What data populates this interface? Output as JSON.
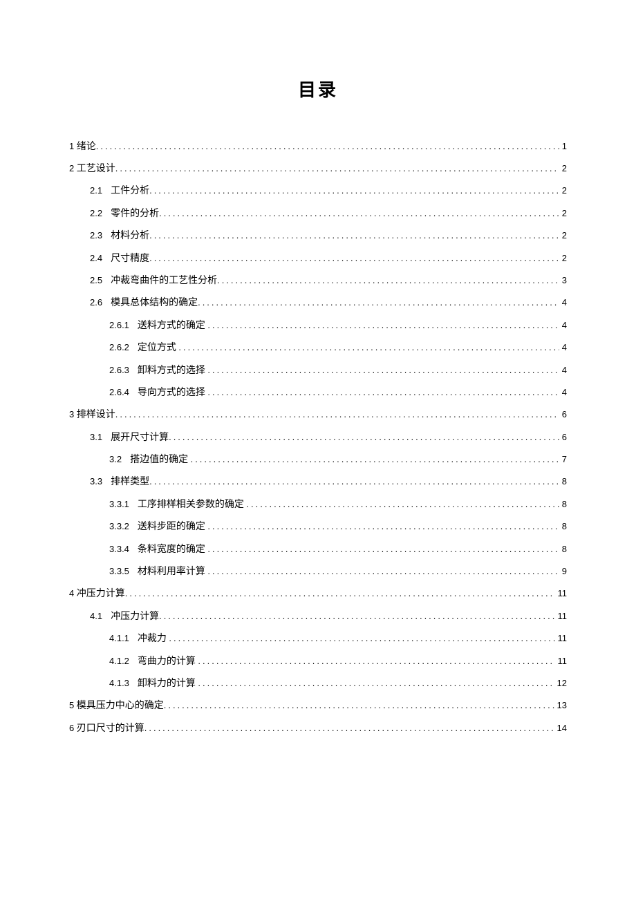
{
  "title": "目录",
  "entries": [
    {
      "level": 0,
      "num": "1",
      "label": "绪论",
      "page": "1",
      "gap": false
    },
    {
      "level": 0,
      "num": "2",
      "label": "工艺设计",
      "page": "2",
      "gap": false
    },
    {
      "level": 1,
      "num": "2.1",
      "label": "工件分析",
      "page": "2",
      "gap": true
    },
    {
      "level": 1,
      "num": "2.2",
      "label": "零件的分析",
      "page": "2",
      "gap": true
    },
    {
      "level": 1,
      "num": "2.3",
      "label": "材料分析",
      "page": "2",
      "gap": true
    },
    {
      "level": 1,
      "num": "2.4",
      "label": "尺寸精度",
      "page": "2",
      "gap": true
    },
    {
      "level": 1,
      "num": "2.5",
      "label": "冲裁弯曲件的工艺性分析",
      "page": "3",
      "gap": true
    },
    {
      "level": 1,
      "num": "2.6",
      "label": "模具总体结构的确定",
      "page": "4",
      "gap": true
    },
    {
      "level": 2,
      "num": "2.6.1",
      "label": "送料方式的确定",
      "page": "4",
      "gap": true
    },
    {
      "level": 2,
      "num": "2.6.2",
      "label": "定位方式",
      "page": "4",
      "gap": true
    },
    {
      "level": 2,
      "num": "2.6.3",
      "label": "卸料方式的选择",
      "page": "4",
      "gap": true
    },
    {
      "level": 2,
      "num": "2.6.4",
      "label": "导向方式的选择",
      "page": "4",
      "gap": true
    },
    {
      "level": 0,
      "num": "3",
      "label": "排样设计",
      "page": "6",
      "gap": false
    },
    {
      "level": 1,
      "num": "3.1",
      "label": "展开尺寸计算",
      "page": "6",
      "gap": true
    },
    {
      "level": 2,
      "num": "3.2",
      "label": "搭边值的确定",
      "page": "7",
      "gap": true
    },
    {
      "level": 1,
      "num": "3.3",
      "label": "排样类型",
      "page": "8",
      "gap": true
    },
    {
      "level": 2,
      "num": "3.3.1",
      "label": "工序排样相关参数的确定",
      "page": "8",
      "gap": true
    },
    {
      "level": 2,
      "num": "3.3.2",
      "label": "送料步距的确定",
      "page": "8",
      "gap": true
    },
    {
      "level": 2,
      "num": "3.3.4",
      "label": "条料宽度的确定",
      "page": "8",
      "gap": true
    },
    {
      "level": 2,
      "num": "3.3.5",
      "label": "材料利用率计算",
      "page": "9",
      "gap": true
    },
    {
      "level": 0,
      "num": "4",
      "label": "冲压力计算",
      "page": "11",
      "gap": false
    },
    {
      "level": 1,
      "num": "4.1",
      "label": "冲压力计算",
      "page": "11",
      "gap": true
    },
    {
      "level": 2,
      "num": "4.1.1",
      "label": "冲裁力",
      "page": "11",
      "gap": true
    },
    {
      "level": 2,
      "num": "4.1.2",
      "label": "弯曲力的计算",
      "page": "11",
      "gap": true
    },
    {
      "level": 2,
      "num": "4.1.3",
      "label": "卸料力的计算",
      "page": "12",
      "gap": true
    },
    {
      "level": 0,
      "num": "5",
      "label": "模具压力中心的确定",
      "page": "13",
      "gap": false
    },
    {
      "level": 0,
      "num": "6",
      "label": "刃口尺寸的计算",
      "page": "14",
      "gap": false
    }
  ]
}
